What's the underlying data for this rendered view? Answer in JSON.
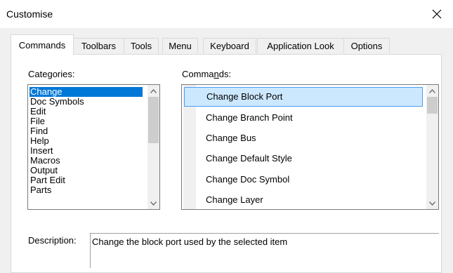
{
  "window": {
    "title": "Customise"
  },
  "tabs": [
    {
      "label": "Commands",
      "active": true
    },
    {
      "label": "Toolbars"
    },
    {
      "label": "Tools"
    },
    {
      "label": "Menu"
    },
    {
      "label": "Keyboard"
    },
    {
      "label": "Application Look"
    },
    {
      "label": "Options"
    }
  ],
  "categories": {
    "label_pre": "Cate",
    "label_u": "g",
    "label_post": "ories:",
    "items": [
      "Change",
      "Doc Symbols",
      "Edit",
      "File",
      "Find",
      "Help",
      "Insert",
      "Macros",
      "Output",
      "Part Edit",
      "Parts"
    ],
    "selected": "Change"
  },
  "commands": {
    "label_pre": "Comma",
    "label_u": "n",
    "label_post": "ds:",
    "items": [
      "Change Block Port",
      "Change Branch Point",
      "Change Bus",
      "Change Default Style",
      "Change Doc Symbol",
      "Change Layer"
    ],
    "selected": "Change Block Port"
  },
  "description": {
    "label": "Description:",
    "text": "Change the block port used by the selected item"
  },
  "icons": {
    "close": "close-icon",
    "scroll_up": "chevron-up-icon",
    "scroll_down": "chevron-down-icon"
  },
  "colors": {
    "selection_blue": "#0078d7",
    "hover_highlight": "#cce8ff",
    "highlight_border": "#4c9ef0"
  }
}
